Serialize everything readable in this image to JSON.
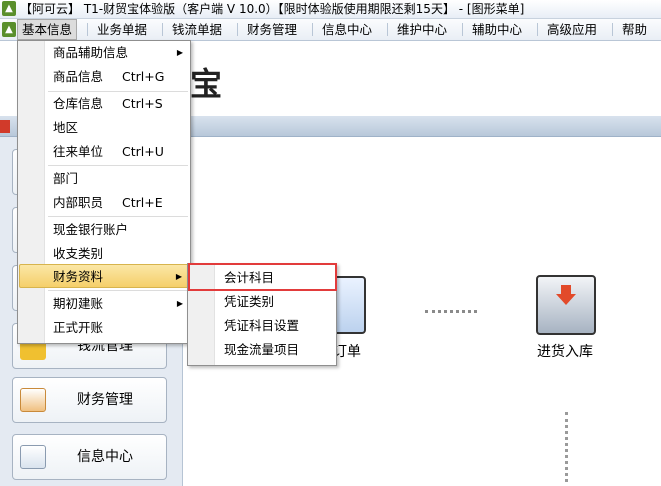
{
  "window": {
    "title": "【阿可云】 T1-财贸宝体验版（客户端 V 10.0）【限时体验版使用期限还剩15天】 - [图形菜单]"
  },
  "menubar": {
    "items": [
      "基本信息",
      "业务单据",
      "钱流单据",
      "财务管理",
      "信息中心",
      "维护中心",
      "辅助中心",
      "高级应用",
      "帮助"
    ]
  },
  "banner": {
    "text": "宝"
  },
  "dropdown": {
    "items": [
      {
        "label": "商品辅助信息",
        "shortcut": "",
        "submenu": true
      },
      {
        "label": "商品信息",
        "shortcut": "Ctrl+G",
        "submenu": false
      },
      {
        "label": "仓库信息",
        "shortcut": "Ctrl+S",
        "submenu": false
      },
      {
        "label": "地区",
        "shortcut": "",
        "submenu": false
      },
      {
        "label": "往来单位",
        "shortcut": "Ctrl+U",
        "submenu": false
      },
      {
        "label": "部门",
        "shortcut": "",
        "submenu": false
      },
      {
        "label": "内部职员",
        "shortcut": "Ctrl+E",
        "submenu": false
      },
      {
        "label": "现金银行账户",
        "shortcut": "",
        "submenu": false
      },
      {
        "label": "收支类别",
        "shortcut": "",
        "submenu": false
      },
      {
        "label": "财务资料",
        "shortcut": "",
        "submenu": true
      },
      {
        "label": "期初建账",
        "shortcut": "",
        "submenu": true
      },
      {
        "label": "正式开账",
        "shortcut": "",
        "submenu": false
      }
    ]
  },
  "submenu": {
    "items": [
      "会计科目",
      "凭证类别",
      "凭证科目设置",
      "现金流量项目"
    ]
  },
  "sidebar": {
    "buttons": [
      "钱流管理",
      "财务管理",
      "信息中心"
    ]
  },
  "flow": {
    "order_label": "订单",
    "purchase_label": "进货入库"
  },
  "colors": {
    "highlight": "#f5cf6a",
    "annotation_box": "#e23b3b",
    "app_green": "#5a8f2c"
  }
}
